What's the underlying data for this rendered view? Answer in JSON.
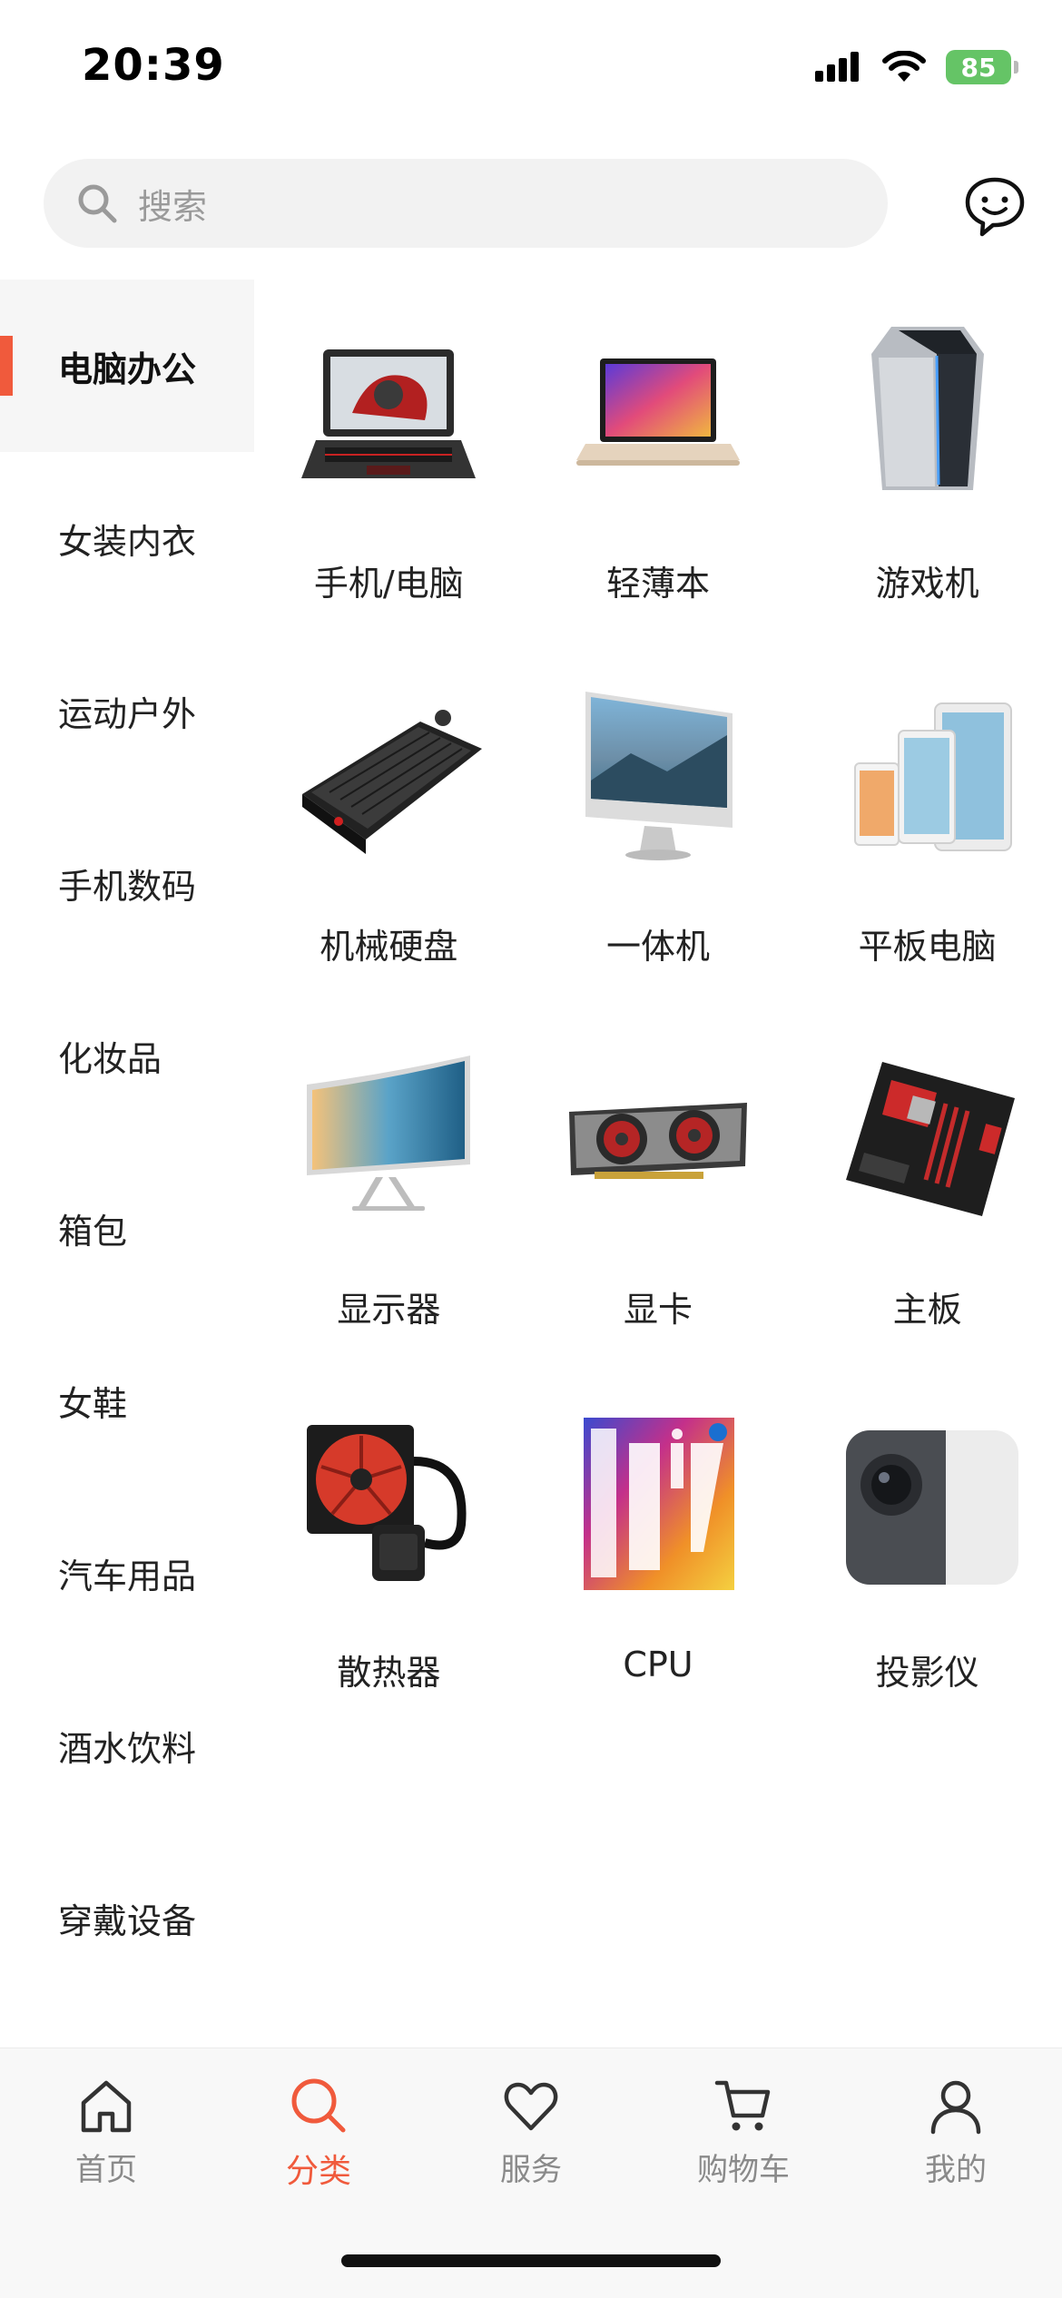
{
  "status": {
    "time": "20:39",
    "battery": "85"
  },
  "search": {
    "placeholder": "搜索",
    "icon": "search-icon",
    "message_icon": "chat-smile-icon"
  },
  "colors": {
    "accent": "#f05a3c",
    "active_bg": "#f6f6f6",
    "tab_inactive": "#8a8a8a"
  },
  "categories": [
    {
      "label": "电脑办公",
      "active": true
    },
    {
      "label": "女装内衣"
    },
    {
      "label": "运动户外"
    },
    {
      "label": "手机数码"
    },
    {
      "label": "化妆品"
    },
    {
      "label": "箱包"
    },
    {
      "label": "女鞋"
    },
    {
      "label": "汽车用品"
    },
    {
      "label": "酒水饮料"
    },
    {
      "label": "穿戴设备"
    }
  ],
  "products": [
    {
      "label": "手机/电脑",
      "icon": "gaming-laptop-image"
    },
    {
      "label": "轻薄本",
      "icon": "ultrabook-image"
    },
    {
      "label": "游戏机",
      "icon": "gaming-pc-tower-image"
    },
    {
      "label": "机械硬盘",
      "icon": "mechanical-keyboard-image"
    },
    {
      "label": "一体机",
      "icon": "all-in-one-pc-image"
    },
    {
      "label": "平板电脑",
      "icon": "tablet-image"
    },
    {
      "label": "显示器",
      "icon": "curved-monitor-image"
    },
    {
      "label": "显卡",
      "icon": "graphics-card-image"
    },
    {
      "label": "主板",
      "icon": "motherboard-image"
    },
    {
      "label": "散热器",
      "icon": "liquid-cooler-image"
    },
    {
      "label": "CPU",
      "icon": "cpu-box-image"
    },
    {
      "label": "投影仪",
      "icon": "projector-image"
    }
  ],
  "tabs": [
    {
      "label": "首页",
      "icon": "home-icon"
    },
    {
      "label": "分类",
      "icon": "search-icon",
      "active": true
    },
    {
      "label": "服务",
      "icon": "heart-icon"
    },
    {
      "label": "购物车",
      "icon": "cart-icon"
    },
    {
      "label": "我的",
      "icon": "user-icon"
    }
  ]
}
